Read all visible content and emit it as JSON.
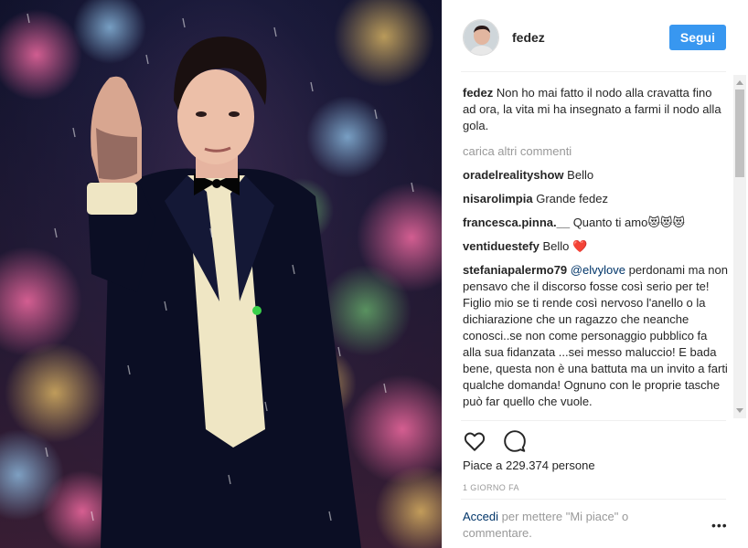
{
  "post": {
    "image_alt": "Performer in black tuxedo with bow tie on stage in the rain, holding up a tattooed hand",
    "author": {
      "username": "fedez",
      "follow_label": "Segui"
    },
    "caption": {
      "username": "fedez",
      "text": "Non ho mai fatto il nodo alla cravatta fino ad ora, la vita mi ha insegnato a farmi il nodo alla gola."
    },
    "load_more_label": "carica altri commenti",
    "comments": [
      {
        "username": "oradelrealityshow",
        "text": "Bello"
      },
      {
        "username": "nisarolimpia",
        "text": "Grande fedez"
      },
      {
        "username": "francesca.pinna.__",
        "text": "Quanto ti amo😻😻😻"
      },
      {
        "username": "ventiduestefy",
        "text": "Bello ❤️"
      },
      {
        "username": "stefaniapalermo79",
        "mention": "@elvylove",
        "text": "perdonami ma non pensavo che il discorso fosse così serio per te! Figlio mio se ti rende così nervoso l'anello o la dichiarazione che un ragazzo che neanche conosci..se non come personaggio pubblico fa alla sua fidanzata ...sei messo maluccio! E bada bene, questa non è una battuta ma un invito a farti qualche domanda! Ognuno con le proprie tasche può far quello che vuole."
      }
    ],
    "likes_text": "Piace a 229.374 persone",
    "timestamp": "1 GIORNO FA",
    "login_prompt": {
      "link_label": "Accedi",
      "text": "per mettere \"Mi piace\" o commentare."
    },
    "more_label": "•••",
    "icons": {
      "like": "heart-icon",
      "comment": "comment-bubble-icon",
      "more": "more-options-icon"
    },
    "colors": {
      "follow_button": "#3897f0",
      "link": "#003569",
      "muted": "#999999"
    }
  }
}
